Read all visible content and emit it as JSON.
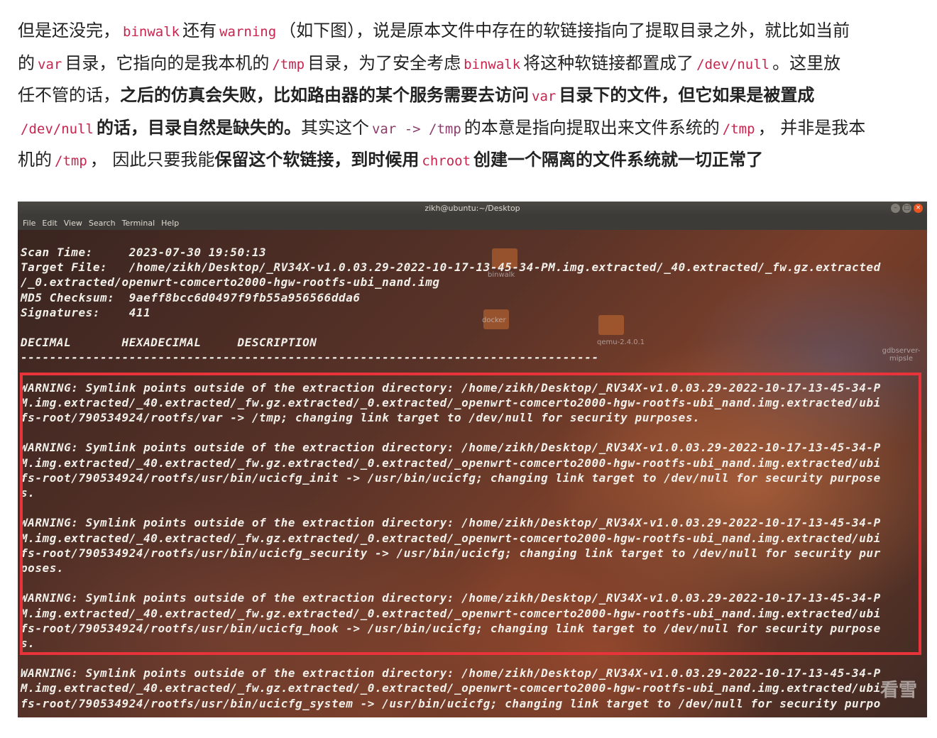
{
  "article": {
    "line1": [
      {
        "t": "但是还没完，"
      },
      {
        "c": "binwalk"
      },
      {
        "t": "还有"
      },
      {
        "c": "warning"
      },
      {
        "t": "（如下图），说是原本文件中存在的软链接指向了提取目录之外，就比如当前"
      }
    ],
    "line2": [
      {
        "t": "的"
      },
      {
        "c": "var"
      },
      {
        "t": "目录，它指向的是我本机的"
      },
      {
        "c": "/tmp"
      },
      {
        "t": "目录，为了安全考虑"
      },
      {
        "c": "binwalk"
      },
      {
        "t": "将这种软链接都置成了"
      },
      {
        "c": "/dev/null"
      },
      {
        "t": "。这里放"
      }
    ],
    "line3": [
      {
        "t": "任不管的话，"
      },
      {
        "b": "之后的仿真会失败，比如路由器的某个服务需要去访问"
      },
      {
        "c": "var"
      },
      {
        "b": "目录下的文件，但它如果是被置成"
      }
    ],
    "line4": [
      {
        "c": "/dev/null"
      },
      {
        "b": "的话，目录自然是缺失的。"
      },
      {
        "t": "其实这个"
      },
      {
        "p": "var -> /tmp"
      },
      {
        "t": "的本意是指向提取出来文件系统的"
      },
      {
        "c": "/tmp"
      },
      {
        "t": "， 并非是我本"
      }
    ],
    "line5": [
      {
        "t": "机的"
      },
      {
        "c": "/tmp"
      },
      {
        "t": "， 因此只要我能"
      },
      {
        "b": "保留这个软链接，到时候用"
      },
      {
        "c": "chroot"
      },
      {
        "b": "创建一个隔离的文件系统就一切正常了"
      }
    ]
  },
  "terminal": {
    "title": "zikh@ubuntu:~/Desktop",
    "menu": [
      "File",
      "Edit",
      "View",
      "Search",
      "Terminal",
      "Help"
    ],
    "lines": [
      "Scan Time:     2023-07-30 19:50:13",
      "Target File:   /home/zikh/Desktop/_RV34X-v1.0.03.29-2022-10-17-13-45-34-PM.img.extracted/_40.extracted/_fw.gz.extracted",
      "/_0.extracted/openwrt-comcerto2000-hgw-rootfs-ubi_nand.img",
      "MD5 Checksum:  9aeff8bcc6d0497f9fb55a956566dda6",
      "Signatures:    411",
      "",
      "DECIMAL       HEXADECIMAL     DESCRIPTION",
      "--------------------------------------------------------------------------------",
      "",
      "WARNING: Symlink points outside of the extraction directory: /home/zikh/Desktop/_RV34X-v1.0.03.29-2022-10-17-13-45-34-P",
      "M.img.extracted/_40.extracted/_fw.gz.extracted/_0.extracted/_openwrt-comcerto2000-hgw-rootfs-ubi_nand.img.extracted/ubi",
      "fs-root/790534924/rootfs/var -> /tmp; changing link target to /dev/null for security purposes.",
      "",
      "WARNING: Symlink points outside of the extraction directory: /home/zikh/Desktop/_RV34X-v1.0.03.29-2022-10-17-13-45-34-P",
      "M.img.extracted/_40.extracted/_fw.gz.extracted/_0.extracted/_openwrt-comcerto2000-hgw-rootfs-ubi_nand.img.extracted/ubi",
      "fs-root/790534924/rootfs/usr/bin/ucicfg_init -> /usr/bin/ucicfg; changing link target to /dev/null for security purpose",
      "s.",
      "",
      "WARNING: Symlink points outside of the extraction directory: /home/zikh/Desktop/_RV34X-v1.0.03.29-2022-10-17-13-45-34-P",
      "M.img.extracted/_40.extracted/_fw.gz.extracted/_0.extracted/_openwrt-comcerto2000-hgw-rootfs-ubi_nand.img.extracted/ubi",
      "fs-root/790534924/rootfs/usr/bin/ucicfg_security -> /usr/bin/ucicfg; changing link target to /dev/null for security pur",
      "poses.",
      "",
      "WARNING: Symlink points outside of the extraction directory: /home/zikh/Desktop/_RV34X-v1.0.03.29-2022-10-17-13-45-34-P",
      "M.img.extracted/_40.extracted/_fw.gz.extracted/_0.extracted/_openwrt-comcerto2000-hgw-rootfs-ubi_nand.img.extracted/ubi",
      "fs-root/790534924/rootfs/usr/bin/ucicfg_hook -> /usr/bin/ucicfg; changing link target to /dev/null for security purpose",
      "s.",
      "",
      "WARNING: Symlink points outside of the extraction directory: /home/zikh/Desktop/_RV34X-v1.0.03.29-2022-10-17-13-45-34-P",
      "M.img.extracted/_40.extracted/_fw.gz.extracted/_0.extracted/_openwrt-comcerto2000-hgw-rootfs-ubi_nand.img.extracted/ubi",
      "fs-root/790534924/rootfs/usr/bin/ucicfg_system -> /usr/bin/ucicfg; changing link target to /dev/null for security purpo"
    ],
    "desktop_icons": [
      "binwalk",
      "docker",
      "qemu-2.4.0.1",
      "gdbserver-mipsle",
      "qemu"
    ],
    "highlight_color": "#e8333a",
    "watermark": "看雪"
  }
}
